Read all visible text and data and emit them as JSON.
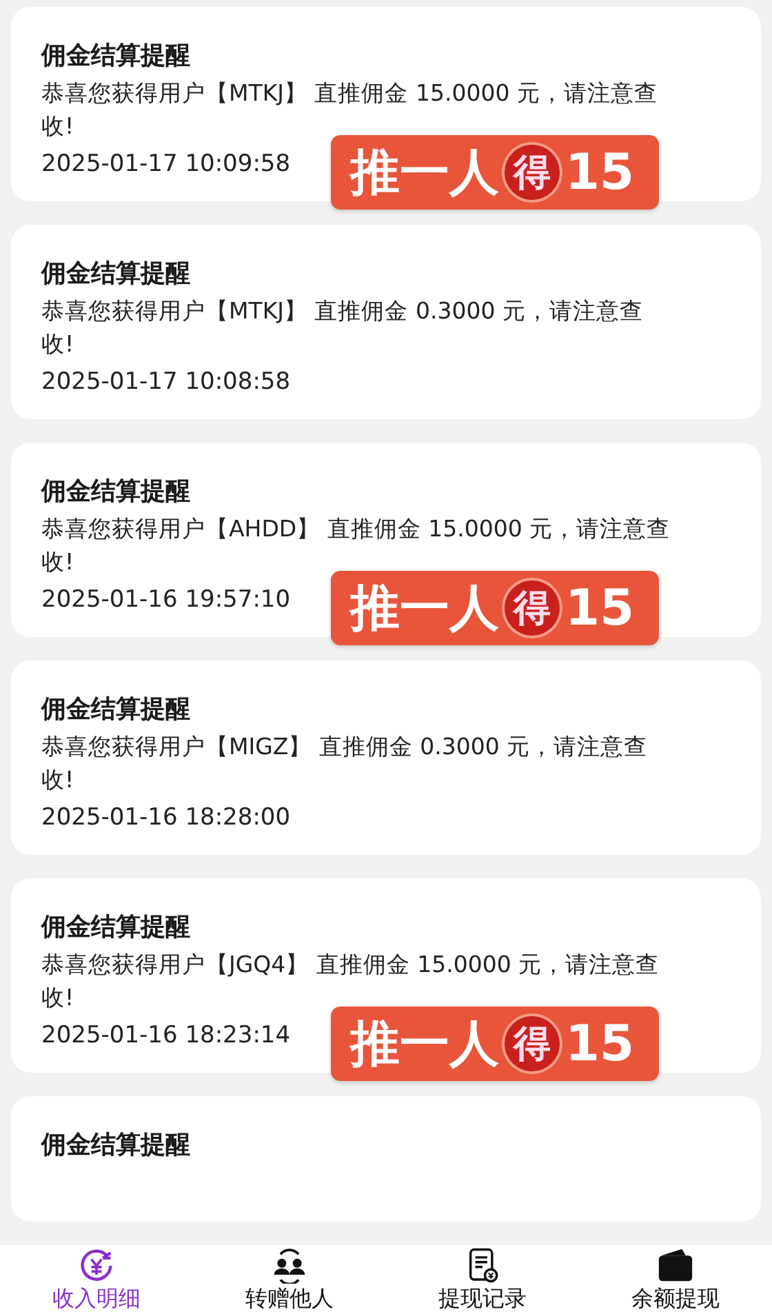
{
  "notices": [
    {
      "title": "佣金结算提醒",
      "message": "恭喜您获得用户【MTKJ】 直推佣金 15.0000 元，请注意查收!",
      "time": "2025-01-17 10:09:58",
      "promo": {
        "lead": "推一人",
        "seal": "得",
        "amount": "15"
      }
    },
    {
      "title": "佣金结算提醒",
      "message": "恭喜您获得用户【MTKJ】 直推佣金 0.3000 元，请注意查收!",
      "time": "2025-01-17 10:08:58"
    },
    {
      "title": "佣金结算提醒",
      "message": "恭喜您获得用户【AHDD】 直推佣金 15.0000 元，请注意查收!",
      "time": "2025-01-16 19:57:10",
      "promo": {
        "lead": "推一人",
        "seal": "得",
        "amount": "15"
      }
    },
    {
      "title": "佣金结算提醒",
      "message": "恭喜您获得用户【MIGZ】 直推佣金 0.3000 元，请注意查收!",
      "time": "2025-01-16 18:28:00"
    },
    {
      "title": "佣金结算提醒",
      "message": "恭喜您获得用户【JGQ4】 直推佣金 15.0000 元，请注意查收!",
      "time": "2025-01-16 18:23:14",
      "promo": {
        "lead": "推一人",
        "seal": "得",
        "amount": "15"
      }
    },
    {
      "title": "佣金结算提醒"
    }
  ],
  "tabbar": [
    {
      "kind": "income",
      "label": "收入明细",
      "selected": true
    },
    {
      "kind": "transfer",
      "label": "转赠他人",
      "selected": false
    },
    {
      "kind": "records",
      "label": "提现记录",
      "selected": false
    },
    {
      "kind": "wallet",
      "label": "余额提现",
      "selected": false
    }
  ]
}
